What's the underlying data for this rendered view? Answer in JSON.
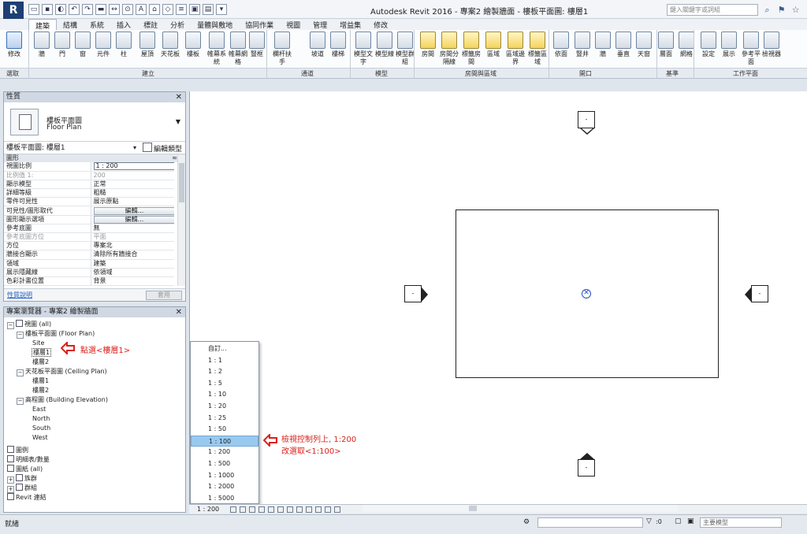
{
  "window": {
    "title": "Autodesk Revit 2016 -    專案2 繪製牆面 - 樓板平面圖: 樓層1",
    "search_placeholder": "鍵入關鍵字或詞組",
    "app_logo": "R"
  },
  "ribbon": {
    "tabs": [
      "建築",
      "結構",
      "系統",
      "插入",
      "標註",
      "分析",
      "量體與敷地",
      "協同作業",
      "視圖",
      "管理",
      "增益集",
      "修改"
    ],
    "active_tab": "建築",
    "buttons": [
      {
        "label": "修改",
        "icon": "cursor-icon"
      },
      {
        "label": "牆",
        "icon": "wall-icon"
      },
      {
        "label": "門",
        "icon": "door-icon"
      },
      {
        "label": "窗",
        "icon": "window-icon"
      },
      {
        "label": "元件",
        "icon": "component-icon"
      },
      {
        "label": "柱",
        "icon": "column-icon"
      },
      {
        "label": "屋頂",
        "icon": "roof-icon"
      },
      {
        "label": "天花板",
        "icon": "ceiling-icon"
      },
      {
        "label": "樓板",
        "icon": "floor-icon"
      },
      {
        "label": "帷幕系統",
        "icon": "curtain-system-icon"
      },
      {
        "label": "帷幕網格",
        "icon": "curtain-grid-icon"
      },
      {
        "label": "豎框",
        "icon": "mullion-icon"
      },
      {
        "label": "欄杆扶手",
        "icon": "railing-icon"
      },
      {
        "label": "坡道",
        "icon": "ramp-icon"
      },
      {
        "label": "樓梯",
        "icon": "stair-icon"
      },
      {
        "label": "模型文字",
        "icon": "model-text-icon"
      },
      {
        "label": "模型線",
        "icon": "model-line-icon"
      },
      {
        "label": "模型群組",
        "icon": "model-group-icon"
      },
      {
        "label": "房間",
        "icon": "room-icon"
      },
      {
        "label": "房間分隔線",
        "icon": "room-separator-icon"
      },
      {
        "label": "標籤房間",
        "icon": "tag-room-icon"
      },
      {
        "label": "區域",
        "icon": "area-icon"
      },
      {
        "label": "區域邊界",
        "icon": "area-boundary-icon"
      },
      {
        "label": "標籤區域",
        "icon": "tag-area-icon"
      },
      {
        "label": "依面",
        "icon": "by-face-icon"
      },
      {
        "label": "豎井",
        "icon": "shaft-icon"
      },
      {
        "label": "牆",
        "icon": "wall-opening-icon"
      },
      {
        "label": "垂直",
        "icon": "vertical-opening-icon"
      },
      {
        "label": "天窗",
        "icon": "dormer-icon"
      },
      {
        "label": "層面",
        "icon": "level-icon"
      },
      {
        "label": "網格",
        "icon": "grid-icon"
      },
      {
        "label": "設定",
        "icon": "set-icon"
      },
      {
        "label": "展示",
        "icon": "show-icon"
      },
      {
        "label": "參考平面",
        "icon": "ref-plane-icon"
      },
      {
        "label": "檢視器",
        "icon": "viewer-icon"
      }
    ],
    "groups": [
      "選取",
      "建立",
      "通道",
      "模型",
      "房間與區域",
      "開口",
      "基準",
      "工作平面"
    ]
  },
  "properties": {
    "title": "性質",
    "type_line1": "樓板平面圖",
    "type_line2": "Floor Plan",
    "instance_label": "樓板平面圖: 樓層1",
    "edit_type": "編輯類型",
    "group": "圖形",
    "rows": [
      {
        "k": "視圖比例",
        "v": "1 : 200",
        "style": "input"
      },
      {
        "k": "比例值 1:",
        "v": "200",
        "style": "gray"
      },
      {
        "k": "顯示模型",
        "v": "正常",
        "style": ""
      },
      {
        "k": "詳細等級",
        "v": "粗糙",
        "style": ""
      },
      {
        "k": "零件可見性",
        "v": "展示原點",
        "style": ""
      },
      {
        "k": "可見性/圖形取代",
        "v": "編輯...",
        "style": "button"
      },
      {
        "k": "圖形顯示選項",
        "v": "編輯...",
        "style": "button"
      },
      {
        "k": "參考底圖",
        "v": "無",
        "style": ""
      },
      {
        "k": "參考底圖方位",
        "v": "平面",
        "style": "gray"
      },
      {
        "k": "方位",
        "v": "專案北",
        "style": ""
      },
      {
        "k": "牆接合顯示",
        "v": "清除所有牆接合",
        "style": ""
      },
      {
        "k": "領域",
        "v": "建築",
        "style": ""
      },
      {
        "k": "展示隱藏線",
        "v": "依領域",
        "style": ""
      },
      {
        "k": "色彩計畫位置",
        "v": "背景",
        "style": ""
      }
    ],
    "help_link": "性質說明",
    "apply": "套用"
  },
  "browser": {
    "title": "專案瀏覽器 - 專案2 繪製牆面",
    "nodes": [
      {
        "label": "視圖 (all)",
        "level": 0,
        "toggle": "-",
        "icon": "views-icon"
      },
      {
        "label": "樓板平面圖 (Floor Plan)",
        "level": 1,
        "toggle": "-"
      },
      {
        "label": "Site",
        "level": 2
      },
      {
        "label": "樓層1",
        "level": 2,
        "selected": true
      },
      {
        "label": "樓層2",
        "level": 2
      },
      {
        "label": "天花板平面圖 (Ceiling Plan)",
        "level": 1,
        "toggle": "-"
      },
      {
        "label": "樓層1",
        "level": 2
      },
      {
        "label": "樓層2",
        "level": 2
      },
      {
        "label": "高程圖 (Building Elevation)",
        "level": 1,
        "toggle": "-"
      },
      {
        "label": "East",
        "level": 2
      },
      {
        "label": "North",
        "level": 2
      },
      {
        "label": "South",
        "level": 2
      },
      {
        "label": "West",
        "level": 2
      },
      {
        "label": "圖例",
        "level": 0,
        "icon": "legend-icon"
      },
      {
        "label": "明細表/數量",
        "level": 0,
        "icon": "schedule-icon"
      },
      {
        "label": "圖紙 (all)",
        "level": 0,
        "icon": "sheet-icon"
      },
      {
        "label": "族群",
        "level": 0,
        "toggle": "+",
        "icon": "family-icon"
      },
      {
        "label": "群組",
        "level": 0,
        "toggle": "+",
        "icon": "group-icon"
      },
      {
        "label": "Revit 連結",
        "level": 0,
        "icon": "link-icon"
      }
    ]
  },
  "annotations": {
    "click_level": "點選<樓層1>",
    "change_scale_line1": "檢視控制列上, 1:200",
    "change_scale_line2": "改選取<1:100>"
  },
  "scale_menu": {
    "items": [
      "自訂...",
      "1 : 1",
      "1 : 2",
      "1 : 5",
      "1 : 10",
      "1 : 20",
      "1 : 25",
      "1 : 50",
      "1 : 100",
      "1 : 200",
      "1 : 500",
      "1 : 1000",
      "1 : 2000",
      "1 : 5000"
    ],
    "selected": "1 : 100"
  },
  "view_control": {
    "scale": "1 : 200"
  },
  "status": {
    "text": "就緒",
    "count": ":0",
    "model": "主要模型"
  },
  "colors": {
    "annotation_red": "#d9221c",
    "selection_blue": "#99c9ef",
    "origin_blue": "#2450c8"
  }
}
